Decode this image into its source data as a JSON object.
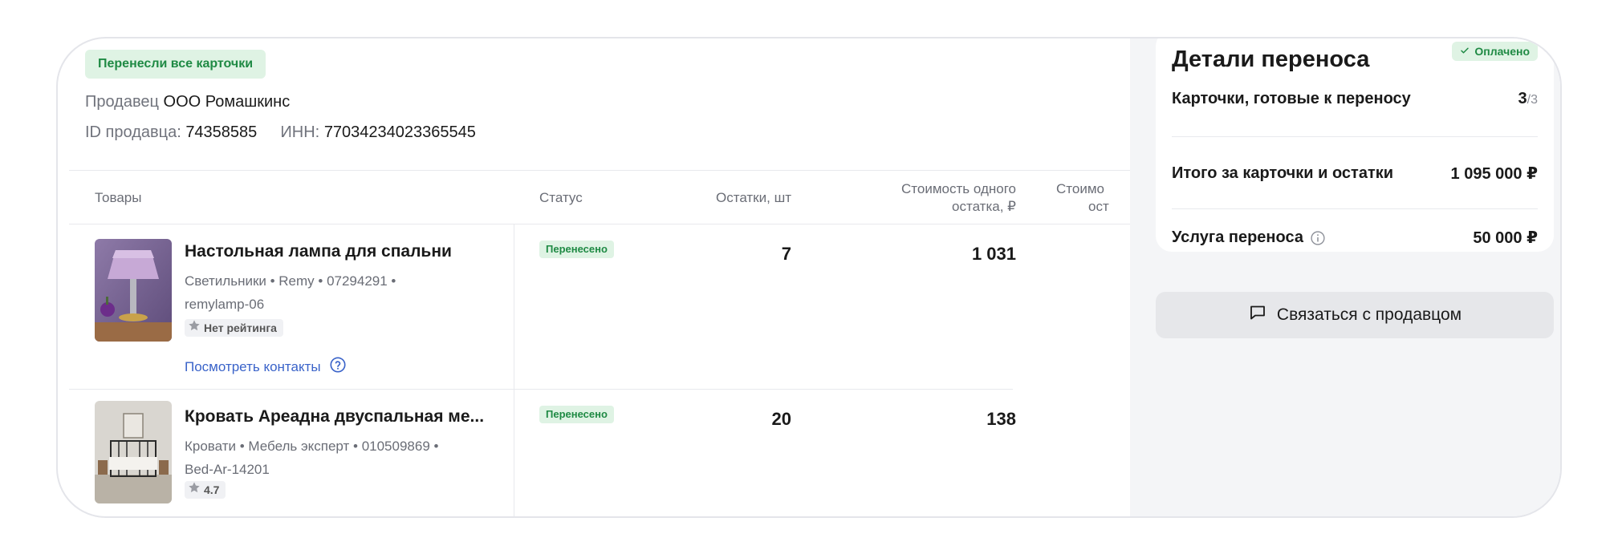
{
  "header": {
    "badge": "Перенесли все карточки",
    "seller_label": "Продавец",
    "seller_name": "ООО Ромашкинс",
    "seller_id_label": "ID продавца:",
    "seller_id": "74358585",
    "inn_label": "ИНН:",
    "inn": "77034234023365545"
  },
  "table": {
    "columns": {
      "goods": "Товары",
      "status": "Статус",
      "stock": "Остатки, шт",
      "price_line1": "Стоимость одного",
      "price_line2": "остатка, ₽",
      "cost_line1": "Стоимо",
      "cost_line2": "ост"
    },
    "rows": [
      {
        "name": "Настольная лампа для спальни",
        "meta_line1": "Светильники • Remy • 07294291 •",
        "meta_line2": "remylamp-06",
        "rating": "Нет рейтинга",
        "contacts": "Посмотреть контакты",
        "status": "Перенесено",
        "stock": "7",
        "price": "1 031"
      },
      {
        "name": "Кровать Ареадна двуспальная ме...",
        "meta_line1": "Кровати • Мебель эксперт • 010509869 •",
        "meta_line2": "Bed-Ar-14201",
        "rating": "4.7",
        "status": "Перенесено",
        "stock": "20",
        "price": "138"
      }
    ]
  },
  "details": {
    "title": "Детали переноса",
    "paid": "Оплачено",
    "ready_label": "Карточки, готовые к переносу",
    "ready_value": "3",
    "ready_total": "/3",
    "total_label": "Итого за карточки и остатки",
    "total_value": "1 095 000 ₽",
    "service_label": "Услуга переноса",
    "service_value": "50 000 ₽"
  },
  "contact_button": "Связаться с продавцом",
  "colors": {
    "success_bg": "#dff3e4",
    "success_text": "#1f8a44",
    "link": "#3a63c9",
    "sidebar_bg": "#f4f5f7"
  },
  "icons": [
    "star-icon",
    "question-circle-icon",
    "check-icon",
    "info-icon",
    "chat-icon"
  ]
}
